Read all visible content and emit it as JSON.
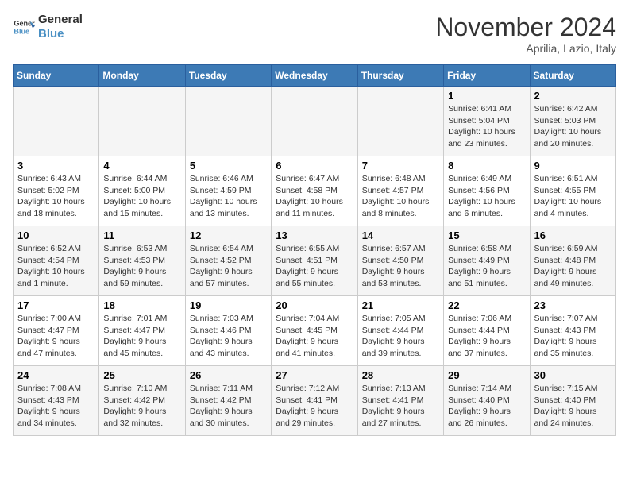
{
  "logo": {
    "line1": "General",
    "line2": "Blue"
  },
  "title": "November 2024",
  "location": "Aprilia, Lazio, Italy",
  "days_of_week": [
    "Sunday",
    "Monday",
    "Tuesday",
    "Wednesday",
    "Thursday",
    "Friday",
    "Saturday"
  ],
  "weeks": [
    [
      {
        "day": "",
        "info": ""
      },
      {
        "day": "",
        "info": ""
      },
      {
        "day": "",
        "info": ""
      },
      {
        "day": "",
        "info": ""
      },
      {
        "day": "",
        "info": ""
      },
      {
        "day": "1",
        "info": "Sunrise: 6:41 AM\nSunset: 5:04 PM\nDaylight: 10 hours\nand 23 minutes."
      },
      {
        "day": "2",
        "info": "Sunrise: 6:42 AM\nSunset: 5:03 PM\nDaylight: 10 hours\nand 20 minutes."
      }
    ],
    [
      {
        "day": "3",
        "info": "Sunrise: 6:43 AM\nSunset: 5:02 PM\nDaylight: 10 hours\nand 18 minutes."
      },
      {
        "day": "4",
        "info": "Sunrise: 6:44 AM\nSunset: 5:00 PM\nDaylight: 10 hours\nand 15 minutes."
      },
      {
        "day": "5",
        "info": "Sunrise: 6:46 AM\nSunset: 4:59 PM\nDaylight: 10 hours\nand 13 minutes."
      },
      {
        "day": "6",
        "info": "Sunrise: 6:47 AM\nSunset: 4:58 PM\nDaylight: 10 hours\nand 11 minutes."
      },
      {
        "day": "7",
        "info": "Sunrise: 6:48 AM\nSunset: 4:57 PM\nDaylight: 10 hours\nand 8 minutes."
      },
      {
        "day": "8",
        "info": "Sunrise: 6:49 AM\nSunset: 4:56 PM\nDaylight: 10 hours\nand 6 minutes."
      },
      {
        "day": "9",
        "info": "Sunrise: 6:51 AM\nSunset: 4:55 PM\nDaylight: 10 hours\nand 4 minutes."
      }
    ],
    [
      {
        "day": "10",
        "info": "Sunrise: 6:52 AM\nSunset: 4:54 PM\nDaylight: 10 hours\nand 1 minute."
      },
      {
        "day": "11",
        "info": "Sunrise: 6:53 AM\nSunset: 4:53 PM\nDaylight: 9 hours\nand 59 minutes."
      },
      {
        "day": "12",
        "info": "Sunrise: 6:54 AM\nSunset: 4:52 PM\nDaylight: 9 hours\nand 57 minutes."
      },
      {
        "day": "13",
        "info": "Sunrise: 6:55 AM\nSunset: 4:51 PM\nDaylight: 9 hours\nand 55 minutes."
      },
      {
        "day": "14",
        "info": "Sunrise: 6:57 AM\nSunset: 4:50 PM\nDaylight: 9 hours\nand 53 minutes."
      },
      {
        "day": "15",
        "info": "Sunrise: 6:58 AM\nSunset: 4:49 PM\nDaylight: 9 hours\nand 51 minutes."
      },
      {
        "day": "16",
        "info": "Sunrise: 6:59 AM\nSunset: 4:48 PM\nDaylight: 9 hours\nand 49 minutes."
      }
    ],
    [
      {
        "day": "17",
        "info": "Sunrise: 7:00 AM\nSunset: 4:47 PM\nDaylight: 9 hours\nand 47 minutes."
      },
      {
        "day": "18",
        "info": "Sunrise: 7:01 AM\nSunset: 4:47 PM\nDaylight: 9 hours\nand 45 minutes."
      },
      {
        "day": "19",
        "info": "Sunrise: 7:03 AM\nSunset: 4:46 PM\nDaylight: 9 hours\nand 43 minutes."
      },
      {
        "day": "20",
        "info": "Sunrise: 7:04 AM\nSunset: 4:45 PM\nDaylight: 9 hours\nand 41 minutes."
      },
      {
        "day": "21",
        "info": "Sunrise: 7:05 AM\nSunset: 4:44 PM\nDaylight: 9 hours\nand 39 minutes."
      },
      {
        "day": "22",
        "info": "Sunrise: 7:06 AM\nSunset: 4:44 PM\nDaylight: 9 hours\nand 37 minutes."
      },
      {
        "day": "23",
        "info": "Sunrise: 7:07 AM\nSunset: 4:43 PM\nDaylight: 9 hours\nand 35 minutes."
      }
    ],
    [
      {
        "day": "24",
        "info": "Sunrise: 7:08 AM\nSunset: 4:43 PM\nDaylight: 9 hours\nand 34 minutes."
      },
      {
        "day": "25",
        "info": "Sunrise: 7:10 AM\nSunset: 4:42 PM\nDaylight: 9 hours\nand 32 minutes."
      },
      {
        "day": "26",
        "info": "Sunrise: 7:11 AM\nSunset: 4:42 PM\nDaylight: 9 hours\nand 30 minutes."
      },
      {
        "day": "27",
        "info": "Sunrise: 7:12 AM\nSunset: 4:41 PM\nDaylight: 9 hours\nand 29 minutes."
      },
      {
        "day": "28",
        "info": "Sunrise: 7:13 AM\nSunset: 4:41 PM\nDaylight: 9 hours\nand 27 minutes."
      },
      {
        "day": "29",
        "info": "Sunrise: 7:14 AM\nSunset: 4:40 PM\nDaylight: 9 hours\nand 26 minutes."
      },
      {
        "day": "30",
        "info": "Sunrise: 7:15 AM\nSunset: 4:40 PM\nDaylight: 9 hours\nand 24 minutes."
      }
    ]
  ]
}
